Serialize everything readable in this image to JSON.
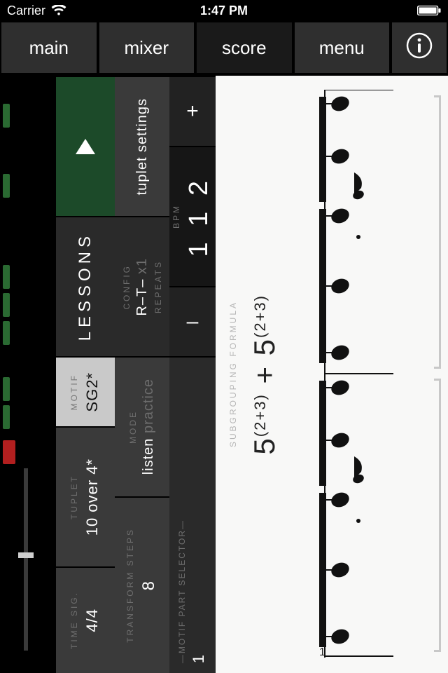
{
  "status": {
    "carrier": "Carrier",
    "time": "1:47 PM"
  },
  "nav": {
    "main": "main",
    "mixer": "mixer",
    "score": "score",
    "menu": "menu"
  },
  "strip2": {
    "lessons": "LESSONS",
    "motif_label": "MOTIF",
    "motif_value": "SG2*",
    "tuplet_label": "TUPLET",
    "tuplet_value": "10 over 4*",
    "timesig_label": "TIME SIG.",
    "timesig_value": "4/4"
  },
  "strip3": {
    "tuplet_settings": "tuplet settings",
    "config_label": "CONFIG",
    "config_value": "R–T–",
    "repeats_label": "REPEATS",
    "repeats_value": " x1",
    "mode_label": "MODE",
    "mode_listen": "listen",
    "mode_practice": "practice",
    "transform_label": "TRANSFORM STEPS",
    "transform_value": "8"
  },
  "strip4": {
    "plus": "+",
    "bpm_label": "BPM",
    "bpm_value": "1 1 2",
    "minus": "–",
    "selector_label": "MOTIF PART  SELECTOR",
    "selector_value": "1"
  },
  "score": {
    "subgroup_label": "SUBGROUPING FORMULA",
    "formula_left": "5",
    "formula_leftsup": "(2+3)",
    "formula_plus": " + ",
    "formula_right": "5",
    "formula_rightsup": "(2+3)",
    "measure_num": "1"
  },
  "colors": {
    "green": "#1c4a29",
    "red": "#b21f1f"
  }
}
